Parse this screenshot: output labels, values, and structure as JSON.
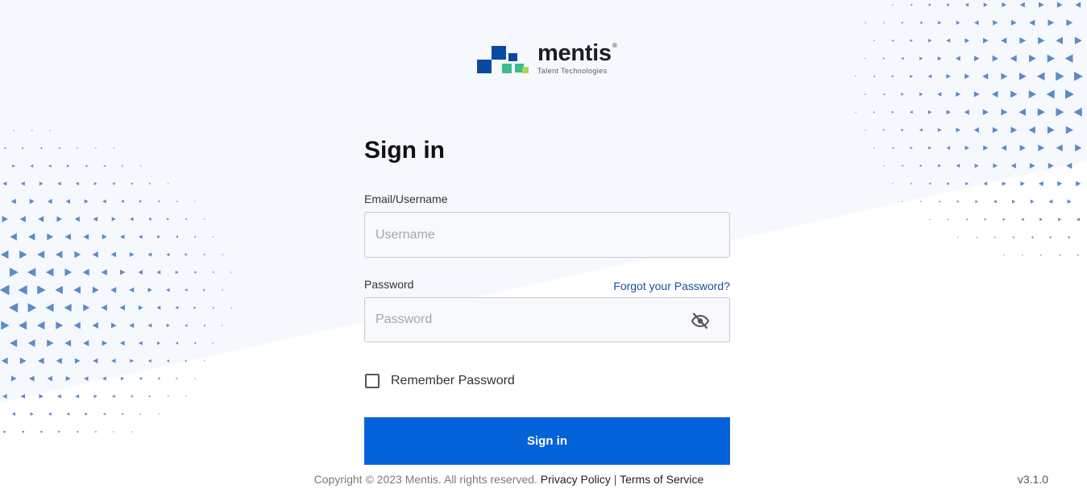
{
  "brand": {
    "name": "mentis",
    "registered_mark": "®",
    "tagline": "Talent Technologies",
    "colors": {
      "navy": "#0b4aa2",
      "teal": "#3dbb8e",
      "lime": "#a7d957",
      "primary_button": "#0462d9",
      "pattern": "#5b8bc8"
    }
  },
  "form": {
    "title": "Sign in",
    "username": {
      "label": "Email/Username",
      "placeholder": "Username",
      "value": ""
    },
    "password": {
      "label": "Password",
      "placeholder": "Password",
      "value": "",
      "toggle_icon": "eye-off-icon"
    },
    "forgot_link": "Forgot your Password?",
    "remember": {
      "label": "Remember Password",
      "checked": false
    },
    "submit_label": "Sign in"
  },
  "footer": {
    "copyright": "Copyright © 2023 Mentis. All rights reserved.",
    "privacy": "Privacy Policy",
    "separator": "|",
    "terms": "Terms of Service",
    "version": "v3.1.0"
  }
}
